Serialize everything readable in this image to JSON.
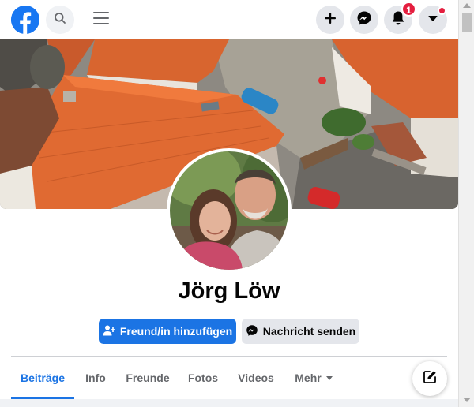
{
  "topbar": {
    "logo_icon": "facebook-logo-icon",
    "search_icon": "search-icon",
    "menu_icon": "hamburger-menu-icon",
    "create_icon": "plus-icon",
    "messenger_icon": "messenger-icon",
    "notifications_icon": "bell-icon",
    "notifications_count": "1",
    "account_icon": "caret-down-icon",
    "brand_color": "#1877f2",
    "badge_color": "#e41e3f"
  },
  "profile": {
    "name": "Jörg Löw",
    "add_friend_label": "Freund/in hinzufügen",
    "message_label": "Nachricht senden"
  },
  "tabs": [
    {
      "label": "Beiträge",
      "active": true
    },
    {
      "label": "Info",
      "active": false
    },
    {
      "label": "Freunde",
      "active": false
    },
    {
      "label": "Fotos",
      "active": false
    },
    {
      "label": "Videos",
      "active": false
    },
    {
      "label": "Mehr",
      "active": false
    }
  ],
  "colors": {
    "accent": "#1b74e4",
    "secondary_button": "#e4e6eb",
    "text_muted": "#65676b"
  }
}
